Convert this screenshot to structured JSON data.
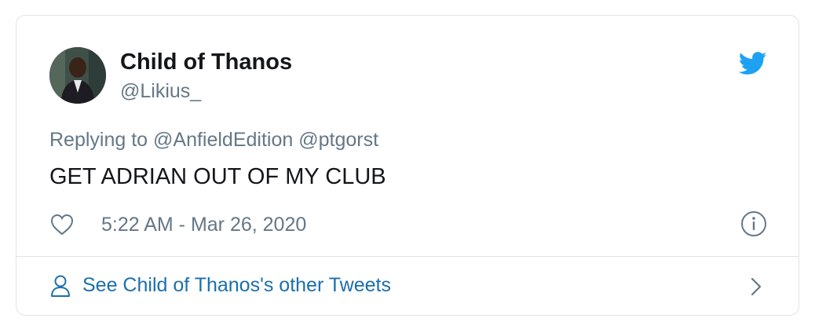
{
  "tweet": {
    "author": {
      "display_name": "Child of Thanos",
      "handle": "@Likius_"
    },
    "replying_to": "Replying to @AnfieldEdition @ptgorst",
    "text": "GET ADRIAN OUT OF MY CLUB",
    "timestamp": "5:22 AM - Mar 26, 2020",
    "footer_link": "See Child of Thanos's other Tweets"
  },
  "icons": {
    "brand": "twitter-bird-icon",
    "like": "heart-icon",
    "info": "info-icon",
    "profile": "person-icon",
    "more": "chevron-right-icon"
  },
  "colors": {
    "brand_blue": "#1da1f2",
    "link_blue": "#1b6fad",
    "secondary_text": "#657786",
    "primary_text": "#14171a",
    "border": "#dfe3e7"
  }
}
